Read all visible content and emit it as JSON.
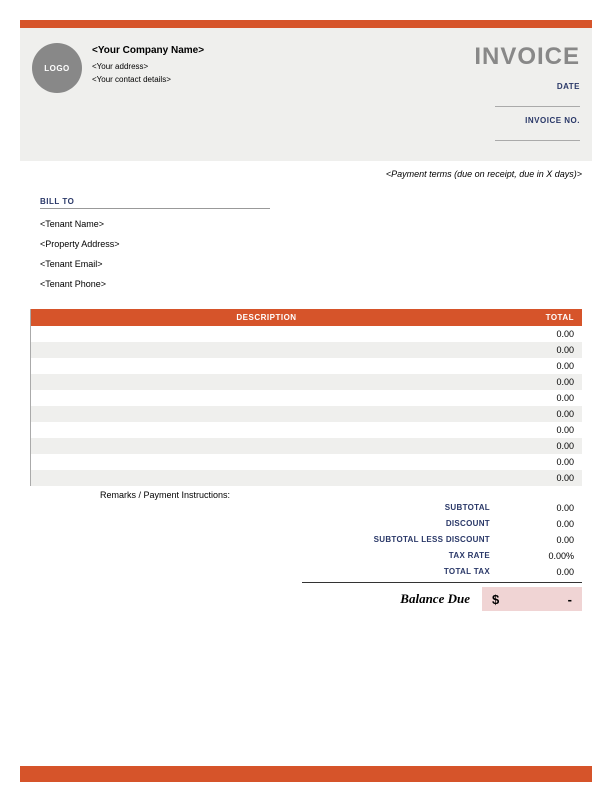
{
  "logo_text": "LOGO",
  "company": {
    "name": "<Your Company Name>",
    "address": "<Your address>",
    "contact": "<Your contact details>"
  },
  "invoice_title": "INVOICE",
  "meta": {
    "date_label": "DATE",
    "invoice_no_label": "INVOICE NO."
  },
  "payment_terms": "<Payment terms (due on receipt, due in X days)>",
  "bill_to": {
    "label": "BILL TO",
    "tenant_name": "<Tenant Name>",
    "property_address": "<Property Address>",
    "tenant_email": "<Tenant Email>",
    "tenant_phone": "<Tenant Phone>"
  },
  "table": {
    "header_desc": "DESCRIPTION",
    "header_total": "TOTAL",
    "rows": [
      {
        "desc": "",
        "total": "0.00"
      },
      {
        "desc": "",
        "total": "0.00"
      },
      {
        "desc": "",
        "total": "0.00"
      },
      {
        "desc": "",
        "total": "0.00"
      },
      {
        "desc": "",
        "total": "0.00"
      },
      {
        "desc": "",
        "total": "0.00"
      },
      {
        "desc": "",
        "total": "0.00"
      },
      {
        "desc": "",
        "total": "0.00"
      },
      {
        "desc": "",
        "total": "0.00"
      },
      {
        "desc": "",
        "total": "0.00"
      }
    ]
  },
  "remarks_label": "Remarks / Payment Instructions:",
  "summary": {
    "subtotal_label": "SUBTOTAL",
    "subtotal_value": "0.00",
    "discount_label": "DISCOUNT",
    "discount_value": "0.00",
    "subtotal_less_label": "SUBTOTAL LESS DISCOUNT",
    "subtotal_less_value": "0.00",
    "tax_rate_label": "TAX RATE",
    "tax_rate_value": "0.00%",
    "total_tax_label": "TOTAL TAX",
    "total_tax_value": "0.00"
  },
  "balance": {
    "label": "Balance Due",
    "currency": "$",
    "value": "-"
  }
}
